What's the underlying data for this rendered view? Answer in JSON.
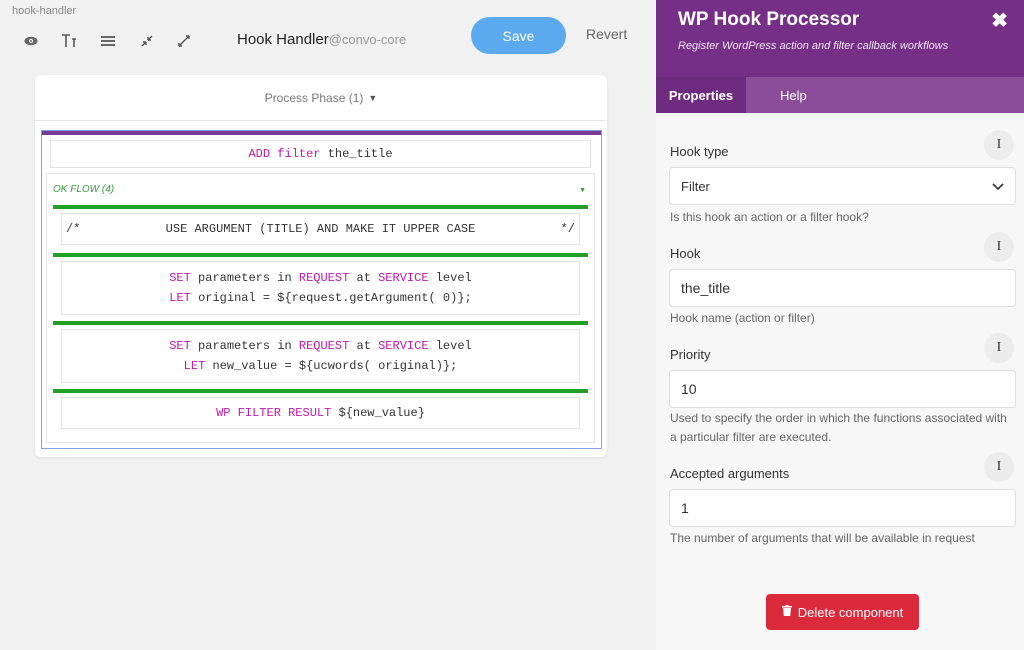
{
  "editor": {
    "breadcrumb": "hook-handler",
    "title": "Hook Handler",
    "title_suffix": "@convo-core",
    "save_label": "Save",
    "revert_label": "Revert",
    "phase_label": "Process Phase (1)",
    "toolbar_icons": [
      "eye-icon",
      "text-size-icon",
      "list-icon",
      "collapse-icon",
      "expand-icon"
    ],
    "add_filter": {
      "keyword": "ADD filter",
      "value": "the_title"
    },
    "ok_flow": {
      "label": "OK FLOW (4)",
      "comment": {
        "open": "/*",
        "text": "USE ARGUMENT (TITLE) AND MAKE IT UPPER CASE",
        "close": "*/"
      },
      "step1": {
        "line1": {
          "k1": "SET",
          "t1": "parameters in",
          "k2": "REQUEST",
          "t2": "at",
          "k3": "SERVICE",
          "t3": "level"
        },
        "line2": {
          "k1": "LET",
          "t1": "original = ${request.getArgument( 0)};"
        }
      },
      "step2": {
        "line1": {
          "k1": "SET",
          "t1": "parameters in",
          "k2": "REQUEST",
          "t2": "at",
          "k3": "SERVICE",
          "t3": "level"
        },
        "line2": {
          "k1": "LET",
          "t1": "new_value = ${ucwords( original)};"
        }
      },
      "step3": {
        "k1": "WP FILTER RESULT",
        "t1": "${new_value}"
      }
    },
    "colors": {
      "keyword": "#c218b2",
      "flow_green": "#23a023",
      "header_purple": "#7b3a96",
      "save_blue": "#5ba9ef"
    }
  },
  "panel": {
    "title": "WP Hook Processor",
    "subtitle": "Register WordPress action and filter callback workflows",
    "tabs": {
      "properties": "Properties",
      "help": "Help"
    },
    "fields": {
      "hook_type": {
        "label": "Hook type",
        "value": "Filter",
        "help": "Is this hook an action or a filter hook?"
      },
      "hook": {
        "label": "Hook",
        "value": "the_title",
        "help": "Hook name (action or filter)"
      },
      "priority": {
        "label": "Priority",
        "value": "10",
        "help": "Used to specify the order in which the functions associated with a particular filter are executed."
      },
      "accepted_args": {
        "label": "Accepted arguments",
        "value": "1",
        "help": "The number of arguments that will be available in request"
      }
    },
    "delete_label": "Delete component",
    "colors": {
      "header": "#752f86",
      "tabs": "#8b4d99",
      "delete": "#db2a3c"
    }
  }
}
